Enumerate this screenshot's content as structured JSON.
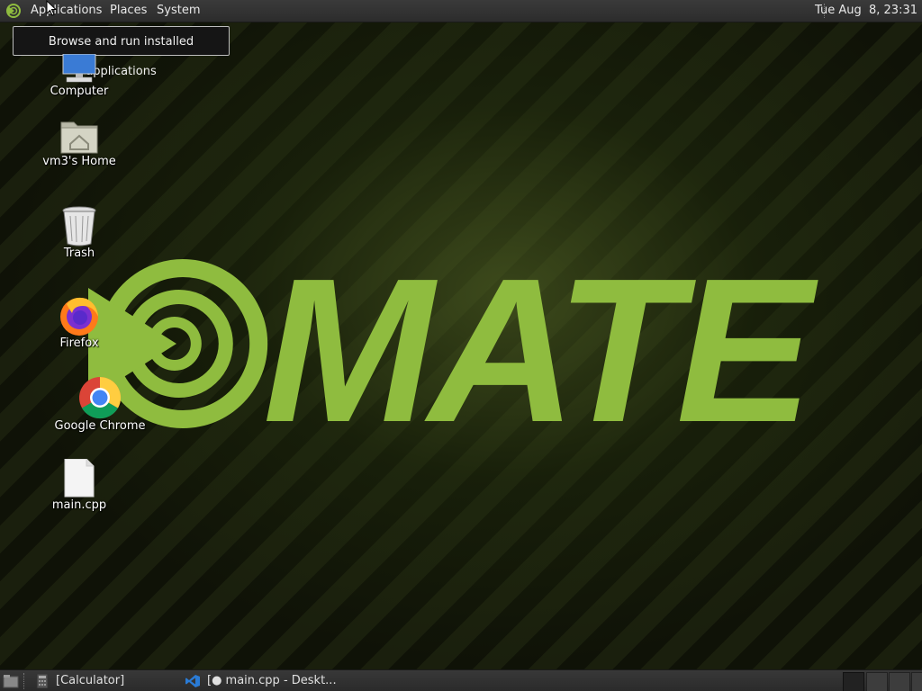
{
  "top_panel": {
    "menus": {
      "applications": "Applications",
      "places": "Places",
      "system": "System"
    },
    "clock": "Tue Aug  8, 23:31"
  },
  "tooltip": {
    "text": "Browse and run installed applications"
  },
  "wallpaper": {
    "logo_text": "MATE",
    "accent_color": "#8fbc3f"
  },
  "desktop_icons": [
    {
      "label": "Computer",
      "icon": "computer-icon"
    },
    {
      "label": "vm3's Home",
      "icon": "home-folder-icon"
    },
    {
      "label": "Trash",
      "icon": "trash-icon"
    },
    {
      "label": "Firefox",
      "icon": "firefox-icon"
    },
    {
      "label": "Google Chrome",
      "icon": "chrome-icon"
    },
    {
      "label": "main.cpp",
      "icon": "text-file-icon"
    }
  ],
  "bottom_panel": {
    "tasks": [
      {
        "label": "[Calculator]",
        "icon": "calculator-icon"
      },
      {
        "label": "[● main.cpp - Deskt...",
        "icon": "vscode-icon"
      }
    ]
  }
}
